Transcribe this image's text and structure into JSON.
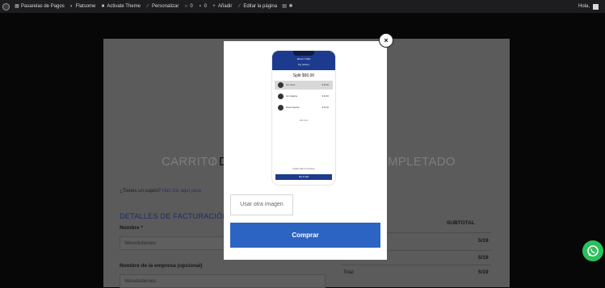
{
  "adminbar": {
    "items": [
      {
        "icon": "dashboard-icon",
        "label": "Pasarelas de Pagos"
      },
      {
        "icon": "theme-icon",
        "label": "Flatsome"
      },
      {
        "icon": "lock-icon",
        "label": "Activate Theme"
      },
      {
        "icon": "pencil-icon",
        "label": "Personalizar"
      },
      {
        "icon": "refresh-icon",
        "label": "0"
      },
      {
        "icon": "comment-icon",
        "label": "0"
      },
      {
        "icon": "plus-icon",
        "label": "Añadir"
      },
      {
        "icon": "edit-icon",
        "label": "Editar la página"
      }
    ],
    "greeting": "Hola,"
  },
  "checkout": {
    "step1": "CARRITO",
    "separator": "/",
    "step2": "D",
    "step3": "MPLETADO",
    "coupon_question": "¿Tienes un cupón?",
    "coupon_link": "Haz clic aquí para",
    "billing_title": "DETALLES DE FACTURACIÓN",
    "name_label": "Nombre *",
    "name_value": "Wesolutiones",
    "company_label": "Nombre de la empresa (opcional)",
    "company_value": "Wesolutiones",
    "subtotal_header": "SUBTOTAL",
    "prices": [
      "5/19",
      "5/19",
      "5/19"
    ],
    "total_label": "Total"
  },
  "modal": {
    "close_symbol": "×",
    "phone": {
      "title": "Eleven In Split",
      "subtitle": "Pay Splitters",
      "split_amount": "Split $90.00",
      "items": [
        {
          "name": "Jon Jones",
          "price": "$ 30.00"
        },
        {
          "name": "Jon Catalina",
          "price": "$ 30.00"
        },
        {
          "name": "Pedro Calorías",
          "price": "$ 30.00"
        }
      ],
      "add_more": "Add more",
      "footer_text": "Update Split & Complete",
      "button": "Pay & Split"
    },
    "alt_image_button": "Usar otra imagen",
    "buy_button": "Comprar"
  },
  "colors": {
    "buy_button": "#2b64c2",
    "phone_header": "#1d3b8e",
    "whatsapp": "#2bc15a"
  }
}
